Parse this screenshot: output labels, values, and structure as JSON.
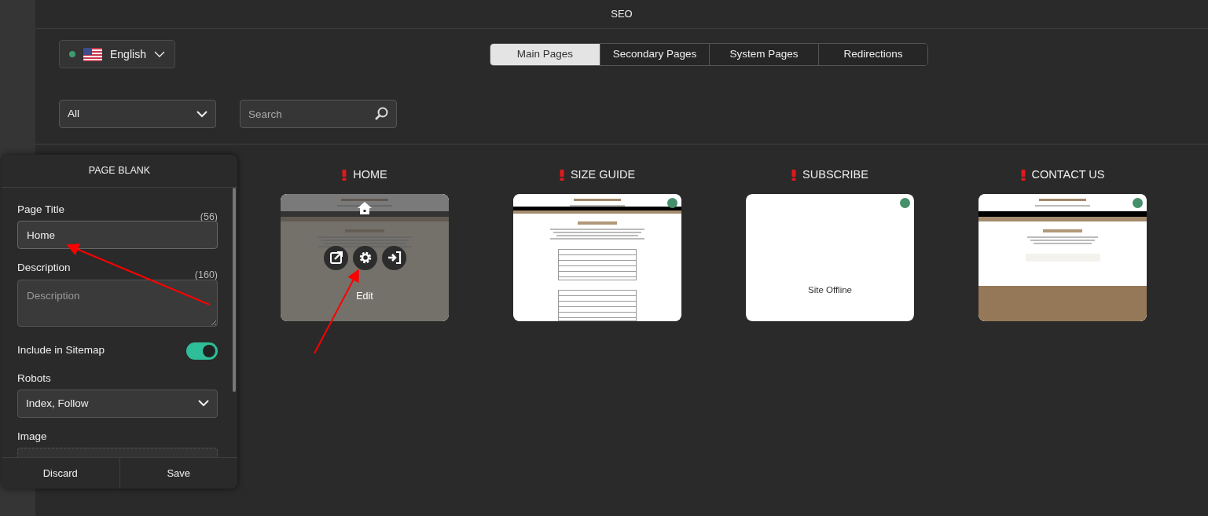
{
  "header": {
    "title": "SEO"
  },
  "language": {
    "label": "English",
    "online": true
  },
  "tabs": [
    {
      "label": "Main Pages",
      "selected": true
    },
    {
      "label": "Secondary Pages",
      "selected": false
    },
    {
      "label": "System Pages",
      "selected": false
    },
    {
      "label": "Redirections",
      "selected": false
    }
  ],
  "filter": {
    "value": "All"
  },
  "search": {
    "placeholder": "Search"
  },
  "pages": [
    {
      "title": "HOME",
      "warning": true,
      "kind": "home",
      "online": false,
      "hovered": true,
      "hover_label": "Edit"
    },
    {
      "title": "SIZE GUIDE",
      "warning": true,
      "kind": "size-guide",
      "online": true,
      "hovered": false
    },
    {
      "title": "SUBSCRIBE",
      "warning": true,
      "kind": "offline",
      "online": true,
      "hovered": false,
      "message": "Site Offline"
    },
    {
      "title": "CONTACT US",
      "warning": true,
      "kind": "contact",
      "online": true,
      "hovered": false
    }
  ],
  "panel": {
    "title": "PAGE BLANK",
    "fields": [
      {
        "kind": "text",
        "label": "Page Title",
        "counter": "(56)",
        "value": "Home"
      },
      {
        "kind": "textarea",
        "label": "Description",
        "counter": "(160)",
        "placeholder": "Description"
      },
      {
        "kind": "switch",
        "label": "Include in Sitemap",
        "on": true
      },
      {
        "kind": "select",
        "label": "Robots",
        "value": "Index, Follow"
      },
      {
        "kind": "image",
        "label": "Image"
      }
    ],
    "buttons": [
      "Discard",
      "Save"
    ]
  }
}
